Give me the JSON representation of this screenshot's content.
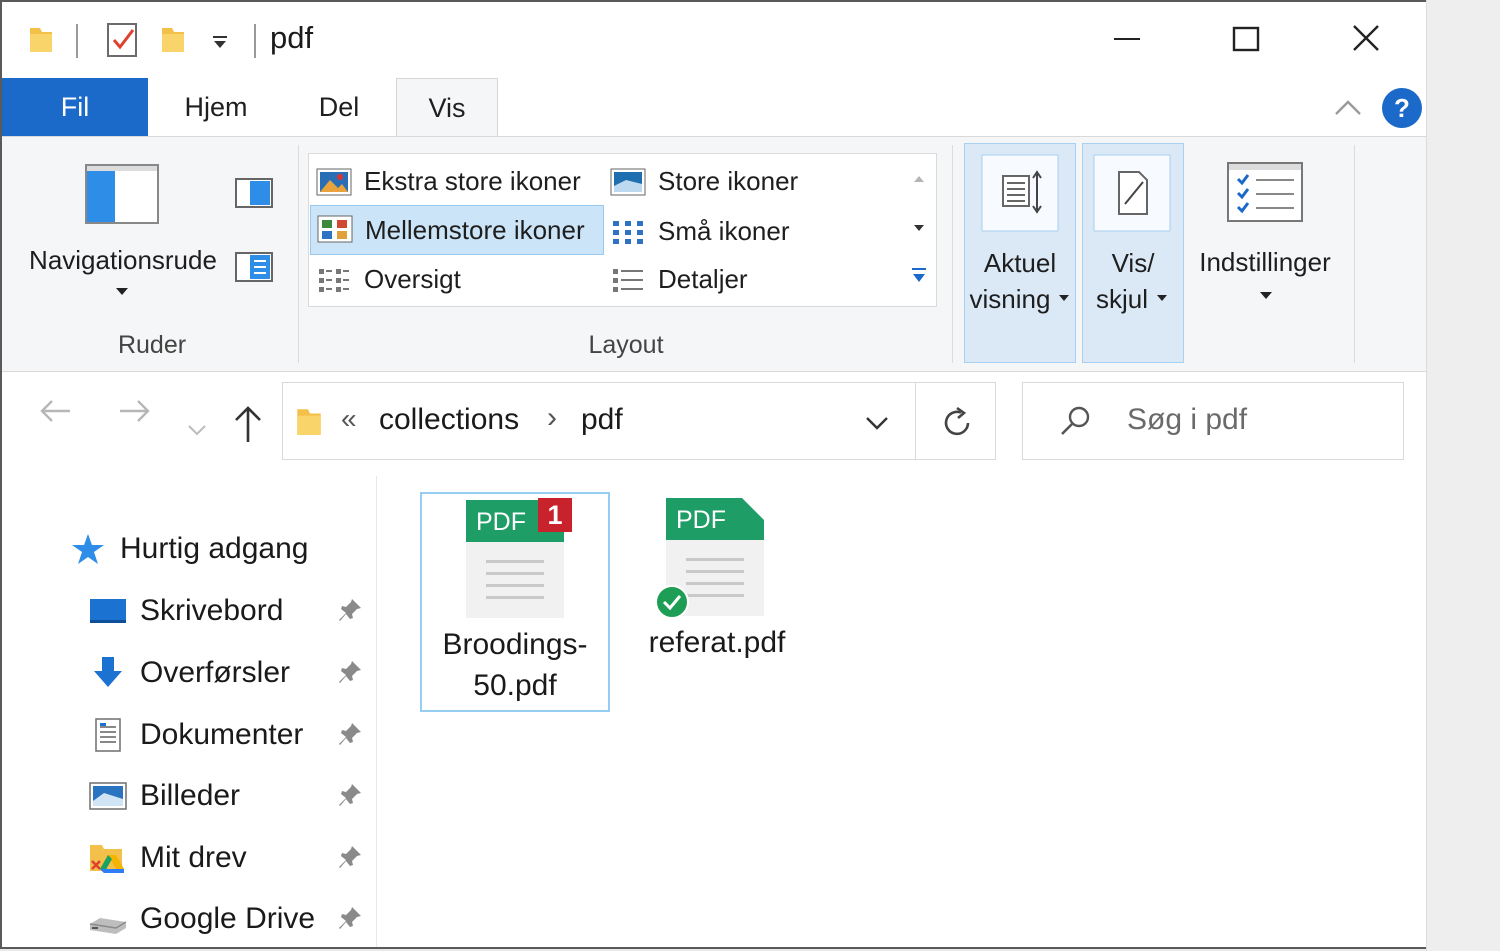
{
  "window": {
    "title": "pdf"
  },
  "tabs": [
    {
      "label": "Fil"
    },
    {
      "label": "Hjem"
    },
    {
      "label": "Del"
    },
    {
      "label": "Vis"
    }
  ],
  "ribbon": {
    "panes": {
      "nav_pane_label": "Navigationsrude",
      "group_label": "Ruder"
    },
    "layout": {
      "group_label": "Layout",
      "items": [
        {
          "label": "Ekstra store ikoner"
        },
        {
          "label": "Store ikoner"
        },
        {
          "label": "Mellemstore ikoner",
          "selected": true
        },
        {
          "label": "Små ikoner"
        },
        {
          "label": "Oversigt"
        },
        {
          "label": "Detaljer"
        }
      ]
    },
    "current_view": {
      "line1": "Aktuel",
      "line2": "visning"
    },
    "show_hide": {
      "line1": "Vis/",
      "line2": "skjul"
    },
    "options": {
      "label": "Indstillinger"
    }
  },
  "address": {
    "overflow": "«",
    "crumbs": [
      "collections",
      "pdf"
    ],
    "separator": "›",
    "search_placeholder": "Søg i pdf"
  },
  "nav_pane": {
    "quick_access": "Hurtig adgang",
    "items": [
      {
        "label": "Skrivebord",
        "icon": "desktop-icon"
      },
      {
        "label": "Overførsler",
        "icon": "downloads-icon"
      },
      {
        "label": "Dokumenter",
        "icon": "documents-icon"
      },
      {
        "label": "Billeder",
        "icon": "pictures-icon"
      },
      {
        "label": "Mit drev",
        "icon": "my-drive-icon"
      },
      {
        "label": "Google Drive",
        "icon": "drive-icon"
      }
    ]
  },
  "files": [
    {
      "name_line1": "Broodings-",
      "name_line2": "50.pdf",
      "badge": "1",
      "icon_text": "PDF",
      "selected": true
    },
    {
      "name_line1": "referat.pdf",
      "name_line2": "",
      "icon_text": "PDF",
      "synced": true
    }
  ],
  "colors": {
    "accent": "#1b69c8",
    "pdf_green": "#1e9e66",
    "badge_red": "#c8232c",
    "help_blue": "#1b69c8"
  }
}
